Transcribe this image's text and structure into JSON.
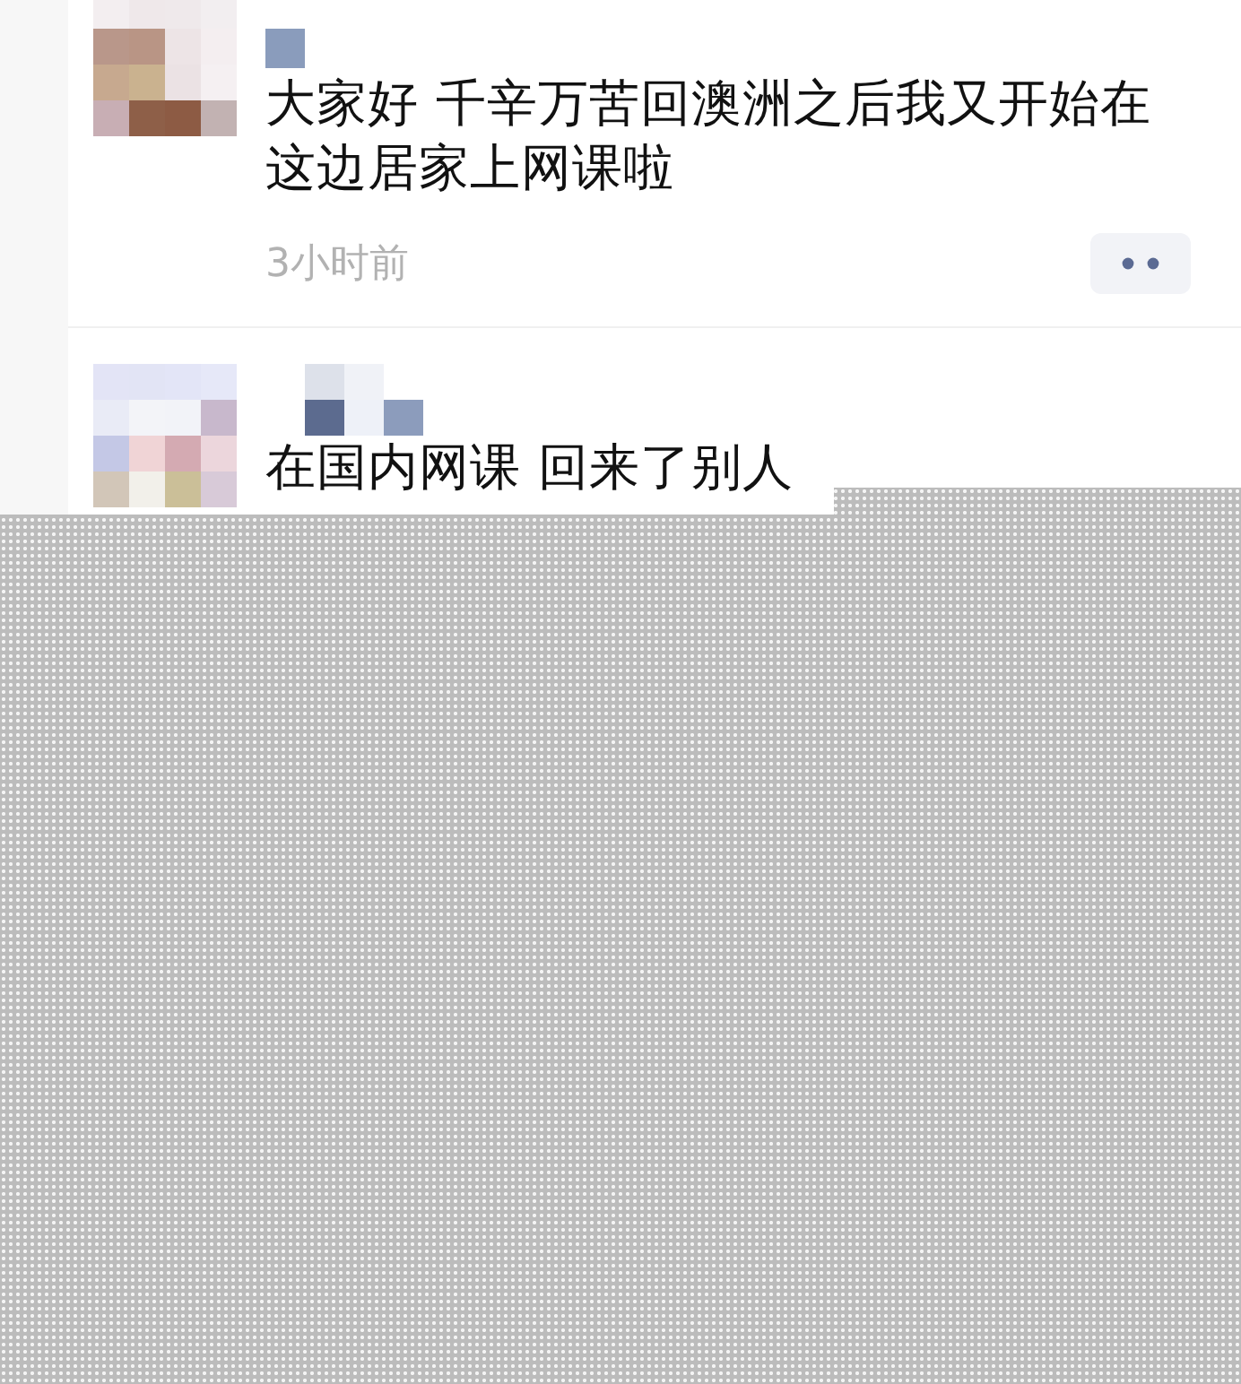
{
  "posts": [
    {
      "text": "大家好 千辛万苦回澳洲之后我又开始在这边居家上网课啦",
      "time": "3小时前"
    },
    {
      "text": "在国内网课 回来了别人"
    }
  ]
}
